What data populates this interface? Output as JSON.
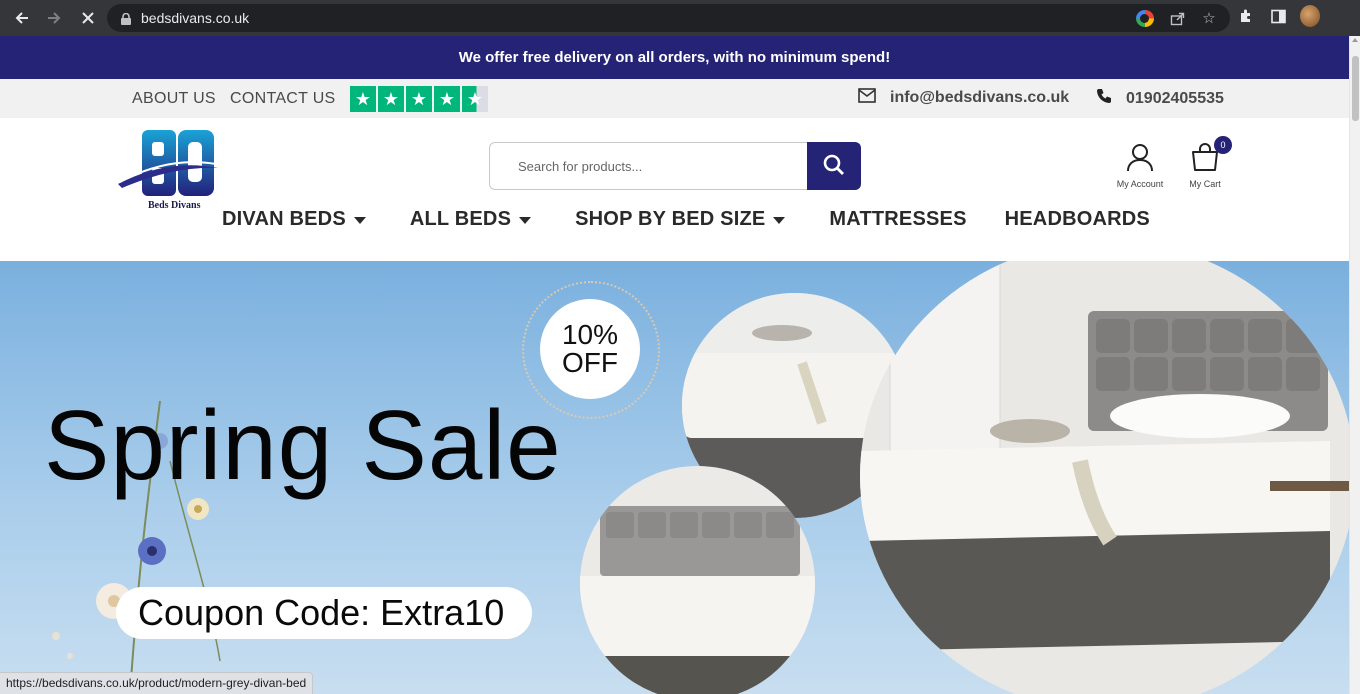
{
  "browser": {
    "url": "bedsdivans.co.uk",
    "status_url": "https://bedsdivans.co.uk/product/modern-grey-divan-bed"
  },
  "announcement": "We offer free delivery on all orders, with no minimum spend!",
  "topbar": {
    "about": "ABOUT US",
    "contact": "CONTACT US",
    "trustpilot_stars": 4.5,
    "email": "info@bedsdivans.co.uk",
    "phone": "01902405535"
  },
  "header": {
    "logo_text": "Beds Divans",
    "search_placeholder": "Search for products...",
    "account_label": "My Account",
    "cart_label": "My Cart",
    "cart_count": "0"
  },
  "nav": [
    {
      "label": "DIVAN BEDS",
      "dropdown": true
    },
    {
      "label": "ALL BEDS",
      "dropdown": true
    },
    {
      "label": "SHOP BY BED SIZE",
      "dropdown": true
    },
    {
      "label": "MATTRESSES",
      "dropdown": false
    },
    {
      "label": "HEADBOARDS",
      "dropdown": false
    }
  ],
  "hero": {
    "title": "Spring Sale",
    "discount_line1": "10%",
    "discount_line2": "OFF",
    "coupon": "Coupon Code: Extra10"
  },
  "colors": {
    "brand": "#242376",
    "trustpilot": "#00b67a"
  }
}
